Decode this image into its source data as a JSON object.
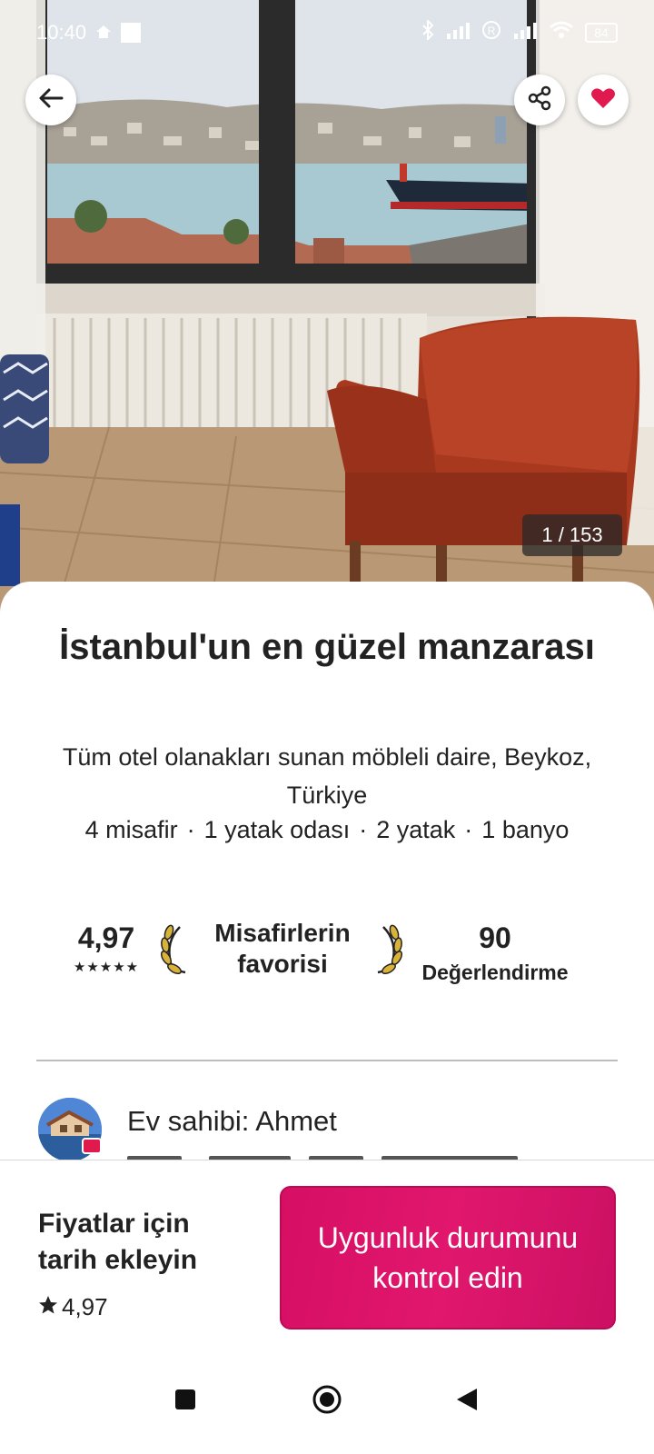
{
  "status_bar": {
    "time": "10:40",
    "battery": "84",
    "icons": [
      "home-icon",
      "square-icon",
      "bluetooth-icon",
      "signal-icon",
      "registered-icon",
      "signal-icon",
      "wifi-icon",
      "battery-icon"
    ]
  },
  "photo": {
    "counter": "1 / 153",
    "back_icon": "arrow-left-icon",
    "share_icon": "share-icon",
    "favorite_icon": "heart-icon",
    "favorite_color": "#e0194f"
  },
  "listing": {
    "title": "İstanbul'un en güzel manzarası",
    "subtitle": "Tüm otel olanakları sunan möbleli daire, Beykoz, Türkiye",
    "details": [
      "4 misafir",
      "1 yatak odası",
      "2 yatak",
      "1 banyo"
    ],
    "details_separator": "·"
  },
  "stats": {
    "rating": "4,97",
    "stars": "★★★★★",
    "favorite_label": "Misafirlerin favorisi",
    "reviews_count": "90",
    "reviews_label": "Değerlendirme"
  },
  "host": {
    "label": "Ev sahibi: Ahmet"
  },
  "booking": {
    "price_prompt": "Fiyatlar için tarih ekleyin",
    "rating": "4,97",
    "cta": "Uygunluk durumunu kontrol edin",
    "cta_color": "#d70f64"
  },
  "nav": {
    "icons": [
      "recent-apps-icon",
      "home-icon",
      "back-icon"
    ]
  }
}
